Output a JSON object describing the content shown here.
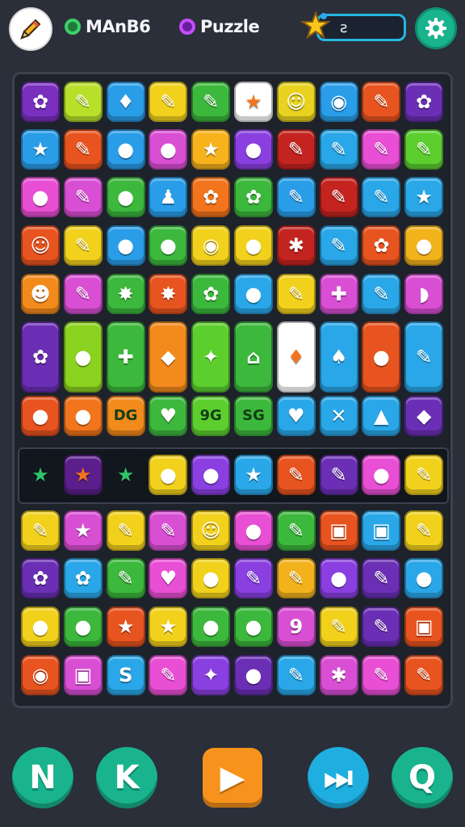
{
  "header": {
    "mode_one_label": "MAnB6",
    "mode_one_color": "#3cd16a",
    "mode_two_label": "Puzzle",
    "mode_two_color": "#c64dff",
    "score_value": "ƨ",
    "pencil_icon": "pencil-icon",
    "star_icon": "star-badge-icon",
    "settings_icon": "gear-icon"
  },
  "board": {
    "rows": [
      [
        {
          "color": "#7a2fbf",
          "glyph": "✿"
        },
        {
          "color": "#b8e02a",
          "glyph": "✎"
        },
        {
          "color": "#2a9de8",
          "glyph": "♦"
        },
        {
          "color": "#f2d11d",
          "glyph": "✎"
        },
        {
          "color": "#3cb83c",
          "glyph": "✎"
        },
        {
          "color": "#ffffff",
          "glyph": "★"
        },
        {
          "color": "#e8d21f",
          "glyph": "☺"
        },
        {
          "color": "#2a9de8",
          "glyph": "◉"
        },
        {
          "color": "#e8541f",
          "glyph": "✎"
        },
        {
          "color": "#6b2fb5",
          "glyph": "✿"
        }
      ],
      [
        {
          "color": "#2a9de8",
          "glyph": "★"
        },
        {
          "color": "#e8541f",
          "glyph": "✎"
        },
        {
          "color": "#2a9de8",
          "glyph": "●"
        },
        {
          "color": "#d94fd4",
          "glyph": "●"
        },
        {
          "color": "#f7b21c",
          "glyph": "★"
        },
        {
          "color": "#8a3fe0",
          "glyph": "●"
        },
        {
          "color": "#c4241f",
          "glyph": "✎"
        },
        {
          "color": "#2aa7e8",
          "glyph": "✎"
        },
        {
          "color": "#e84fd4",
          "glyph": "✎"
        },
        {
          "color": "#5ccf2f",
          "glyph": "✎"
        }
      ],
      [
        {
          "color": "#e84fd4",
          "glyph": "●"
        },
        {
          "color": "#d94fd4",
          "glyph": "✎"
        },
        {
          "color": "#3cb83c",
          "glyph": "●"
        },
        {
          "color": "#2a9de8",
          "glyph": "♟"
        },
        {
          "color": "#f2741c",
          "glyph": "✿"
        },
        {
          "color": "#3cb83c",
          "glyph": "✿"
        },
        {
          "color": "#2a9de8",
          "glyph": "✎"
        },
        {
          "color": "#c4241f",
          "glyph": "✎"
        },
        {
          "color": "#2aa7e8",
          "glyph": "✎"
        },
        {
          "color": "#2aa7e8",
          "glyph": "★"
        }
      ],
      [
        {
          "color": "#e8541f",
          "glyph": "☺"
        },
        {
          "color": "#f2d11d",
          "glyph": "✎"
        },
        {
          "color": "#2a9de8",
          "glyph": "●"
        },
        {
          "color": "#3cb83c",
          "glyph": "●"
        },
        {
          "color": "#f2d11d",
          "glyph": "◉"
        },
        {
          "color": "#f2d11d",
          "glyph": "●"
        },
        {
          "color": "#c4241f",
          "glyph": "✱"
        },
        {
          "color": "#2aa7e8",
          "glyph": "✎"
        },
        {
          "color": "#e8541f",
          "glyph": "✿"
        },
        {
          "color": "#f2b21c",
          "glyph": "●"
        }
      ],
      [
        {
          "color": "#f28a1c",
          "glyph": "☻"
        },
        {
          "color": "#d94fd4",
          "glyph": "✎"
        },
        {
          "color": "#3cb83c",
          "glyph": "✸"
        },
        {
          "color": "#e8541f",
          "glyph": "✸"
        },
        {
          "color": "#3cb83c",
          "glyph": "✿"
        },
        {
          "color": "#2aa7e8",
          "glyph": "●"
        },
        {
          "color": "#f2d11d",
          "glyph": "✎"
        },
        {
          "color": "#d94fd4",
          "glyph": "✚"
        },
        {
          "color": "#2aa7e8",
          "glyph": "✎"
        },
        {
          "color": "#d94fd4",
          "glyph": "◗"
        }
      ],
      [
        {
          "color": "#6b2fb5",
          "glyph": "✿",
          "tall": true
        },
        {
          "color": "#8bd11f",
          "glyph": "●",
          "tall": true
        },
        {
          "color": "#3cb83c",
          "glyph": "✚",
          "tall": true
        },
        {
          "color": "#f28a1c",
          "glyph": "◆",
          "tall": true
        },
        {
          "color": "#5ccf2f",
          "glyph": "✦",
          "tall": true
        },
        {
          "color": "#3cb83c",
          "glyph": "⌂",
          "tall": true
        },
        {
          "color": "#ffffff",
          "glyph": "♦",
          "tall": true
        },
        {
          "color": "#2aa7e8",
          "glyph": "♠",
          "tall": true
        },
        {
          "color": "#e8541f",
          "glyph": "●",
          "tall": true
        },
        {
          "color": "#2aa7e8",
          "glyph": "✎",
          "tall": true
        }
      ],
      [
        {
          "color": "#e8541f",
          "glyph": "●"
        },
        {
          "color": "#f2741c",
          "glyph": "●"
        },
        {
          "color": "#f28a1c",
          "glyph": "DG"
        },
        {
          "color": "#3cb83c",
          "glyph": "♥"
        },
        {
          "color": "#5ccf2f",
          "glyph": "9G"
        },
        {
          "color": "#3cb83c",
          "glyph": "SG"
        },
        {
          "color": "#2aa7e8",
          "glyph": "♥"
        },
        {
          "color": "#2aa7e8",
          "glyph": "✕"
        },
        {
          "color": "#2aa7e8",
          "glyph": "▲"
        },
        {
          "color": "#6b2fb5",
          "glyph": "◆"
        }
      ]
    ],
    "special_row": [
      {
        "color": "#12161d",
        "glyph": "★",
        "fg": "#2fc46a"
      },
      {
        "color": "#5a1f8a",
        "glyph": "★",
        "fg": "#f2741c"
      },
      {
        "color": "#12161d",
        "glyph": "★",
        "fg": "#2fc46a"
      },
      {
        "color": "#f2d11d",
        "glyph": "●"
      },
      {
        "color": "#8a3fe0",
        "glyph": "●"
      },
      {
        "color": "#2aa7e8",
        "glyph": "★"
      },
      {
        "color": "#e8541f",
        "glyph": "✎"
      },
      {
        "color": "#6b2fb5",
        "glyph": "✎"
      },
      {
        "color": "#e84fd4",
        "glyph": "●"
      },
      {
        "color": "#f2d11d",
        "glyph": "✎"
      }
    ],
    "lower_rows": [
      [
        {
          "color": "#f2d11d",
          "glyph": "✎"
        },
        {
          "color": "#d94fd4",
          "glyph": "★"
        },
        {
          "color": "#f2d11d",
          "glyph": "✎"
        },
        {
          "color": "#d94fd4",
          "glyph": "✎"
        },
        {
          "color": "#f2d11d",
          "glyph": "☺"
        },
        {
          "color": "#e84fd4",
          "glyph": "●"
        },
        {
          "color": "#3cb83c",
          "glyph": "✎"
        },
        {
          "color": "#e8541f",
          "glyph": "▣"
        },
        {
          "color": "#2aa7e8",
          "glyph": "▣"
        },
        {
          "color": "#f2d11d",
          "glyph": "✎"
        }
      ],
      [
        {
          "color": "#6b2fb5",
          "glyph": "✿"
        },
        {
          "color": "#2aa7e8",
          "glyph": "✿"
        },
        {
          "color": "#3cb83c",
          "glyph": "✎"
        },
        {
          "color": "#e84fd4",
          "glyph": "♥"
        },
        {
          "color": "#f2d11d",
          "glyph": "●"
        },
        {
          "color": "#8a3fe0",
          "glyph": "✎"
        },
        {
          "color": "#f2b21c",
          "glyph": "✎"
        },
        {
          "color": "#8a3fe0",
          "glyph": "●"
        },
        {
          "color": "#6b2fb5",
          "glyph": "✎"
        },
        {
          "color": "#2aa7e8",
          "glyph": "●"
        }
      ],
      [
        {
          "color": "#f2d11d",
          "glyph": "●"
        },
        {
          "color": "#3cb83c",
          "glyph": "●"
        },
        {
          "color": "#e8541f",
          "glyph": "★"
        },
        {
          "color": "#f2d11d",
          "glyph": "★"
        },
        {
          "color": "#3cb83c",
          "glyph": "●"
        },
        {
          "color": "#3cb83c",
          "glyph": "●"
        },
        {
          "color": "#d94fd4",
          "glyph": "9"
        },
        {
          "color": "#f2d11d",
          "glyph": "✎"
        },
        {
          "color": "#6b2fb5",
          "glyph": "✎"
        },
        {
          "color": "#e8541f",
          "glyph": "▣"
        }
      ],
      [
        {
          "color": "#e8541f",
          "glyph": "◉"
        },
        {
          "color": "#d94fd4",
          "glyph": "▣"
        },
        {
          "color": "#2aa7e8",
          "glyph": "S"
        },
        {
          "color": "#e84fd4",
          "glyph": "✎"
        },
        {
          "color": "#8a3fe0",
          "glyph": "✦"
        },
        {
          "color": "#6b2fb5",
          "glyph": "●"
        },
        {
          "color": "#2aa7e8",
          "glyph": "✎"
        },
        {
          "color": "#d94fd4",
          "glyph": "✱"
        },
        {
          "color": "#e84fd4",
          "glyph": "✎"
        },
        {
          "color": "#e8541f",
          "glyph": "✎"
        }
      ]
    ]
  },
  "controls": [
    {
      "name": "control-n-button",
      "color": "#19b48e",
      "glyph": "N"
    },
    {
      "name": "control-k-button",
      "color": "#19b48e",
      "glyph": "K"
    },
    {
      "name": "control-play-button",
      "color": "#f7931c",
      "glyph": "▶",
      "square": true
    },
    {
      "name": "control-skip-button",
      "color": "#1faee0",
      "glyph": "⏭"
    },
    {
      "name": "control-search-button",
      "color": "#19b48e",
      "glyph": "Q"
    }
  ]
}
